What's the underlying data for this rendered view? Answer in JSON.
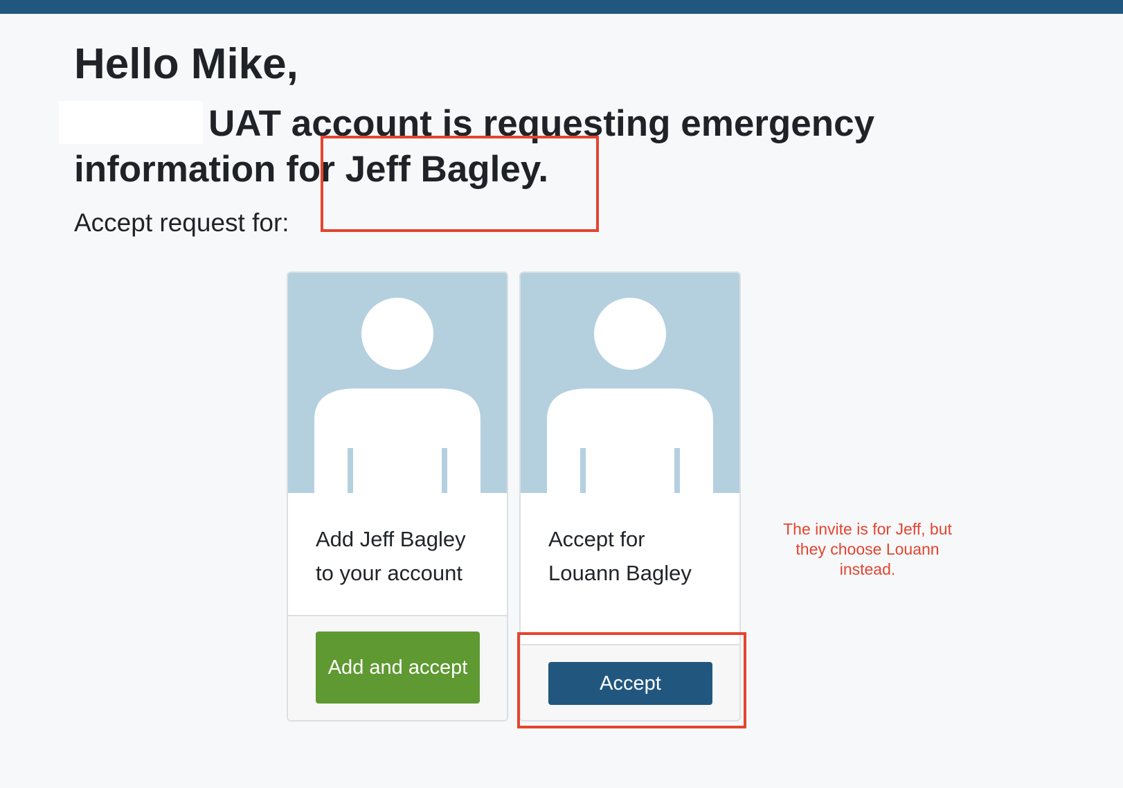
{
  "greeting": "Hello Mike,",
  "request": {
    "redacted_account": "",
    "text": "UAT account is requesting emergency information for Jeff Bagley."
  },
  "subheading": "Accept request for:",
  "cards": [
    {
      "text": "Add Jeff Bagley to your account",
      "button_label": "Add and accept",
      "button_color": "#5e9932"
    },
    {
      "text": "Accept for Louann Bagley",
      "button_label": "Accept",
      "button_color": "#21577f"
    }
  ],
  "annotation": {
    "note": "The invite is for Jeff, but they choose Louann instead.",
    "color": "#e3452f"
  },
  "colors": {
    "topbar": "#21577f",
    "avatar_bg": "#b4d0df",
    "page_bg": "#f7f8fa"
  },
  "icons": {
    "avatar": "person-placeholder-icon"
  }
}
